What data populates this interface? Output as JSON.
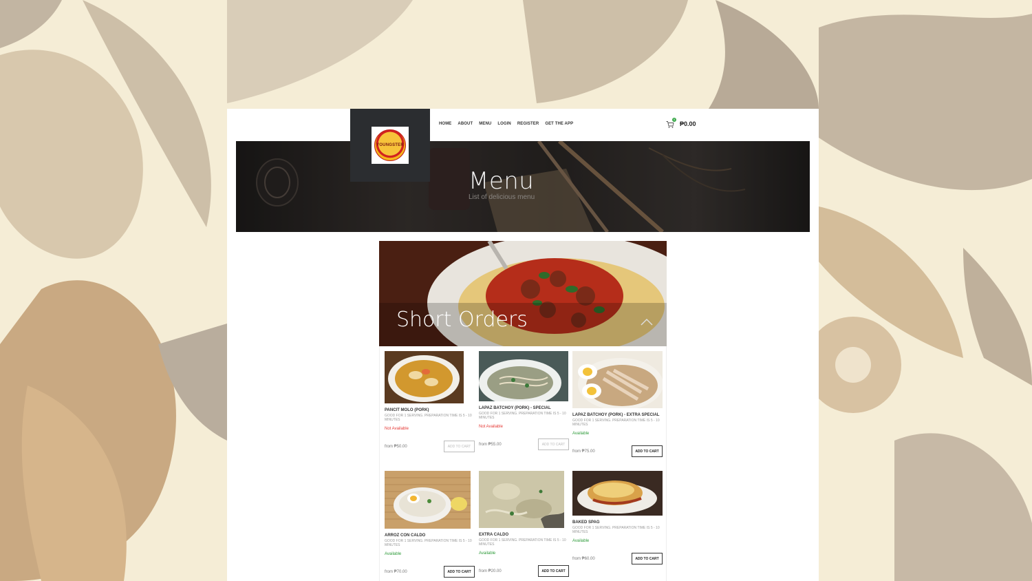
{
  "header": {
    "logo_text": "YOUNGSTER",
    "nav": [
      "HOME",
      "ABOUT",
      "MENU",
      "LOGIN",
      "REGISTER",
      "GET THE APP"
    ],
    "cart": {
      "count": "0",
      "total": "₱0.00"
    }
  },
  "hero": {
    "title": "Menu",
    "subtitle": "List of delicious menu"
  },
  "category": {
    "title": "Short Orders"
  },
  "items": [
    {
      "name": "PANCIT MOLO (PORK)",
      "desc": "GOOD FOR 1 SERVING. PREPARATION TIME IS 5 - 10 MINUTES",
      "status": "Not Available",
      "price": "from ₱50.00",
      "button": "ADD TO CART"
    },
    {
      "name": "LAPAZ BATCHOY (PORK) - SPECIAL",
      "desc": "GOOD FOR 1 SERVING. PREPARATION TIME IS 5 - 10 MINUTES",
      "status": "Not Available",
      "price": "from ₱55.00",
      "button": "ADD TO CART"
    },
    {
      "name": "LAPAZ BATCHOY (PORK) - EXTRA SPECIAL",
      "desc": "GOOD FOR 1 SERVING. PREPARATION TIME IS 5 - 10 MINUTES",
      "status": "Available",
      "price": "from ₱75.00",
      "button": "ADD TO CART"
    },
    {
      "name": "ARROZ CON CALDO",
      "desc": "GOOD FOR 1 SERVING. PREPARATION TIME IS 5 - 10 MINUTES",
      "status": "Available",
      "price": "from ₱70.00",
      "button": "ADD TO CART"
    },
    {
      "name": "EXTRA CALDO",
      "desc": "GOOD FOR 1 SERVING. PREPARATION TIME IS 5 - 10 MINUTES",
      "status": "Available",
      "price": "from ₱20.00",
      "button": "ADD TO CART"
    },
    {
      "name": "BAKED SPAG",
      "desc": "GOOD FOR 1 SERVING. PREPARATION TIME IS 5 - 10 MINUTES",
      "status": "Available",
      "price": "from ₱60.00",
      "button": "ADD TO CART"
    }
  ],
  "colors": {
    "available": "#2e9b3a",
    "not_available": "#e53935",
    "logo_box": "#2b2d30"
  }
}
